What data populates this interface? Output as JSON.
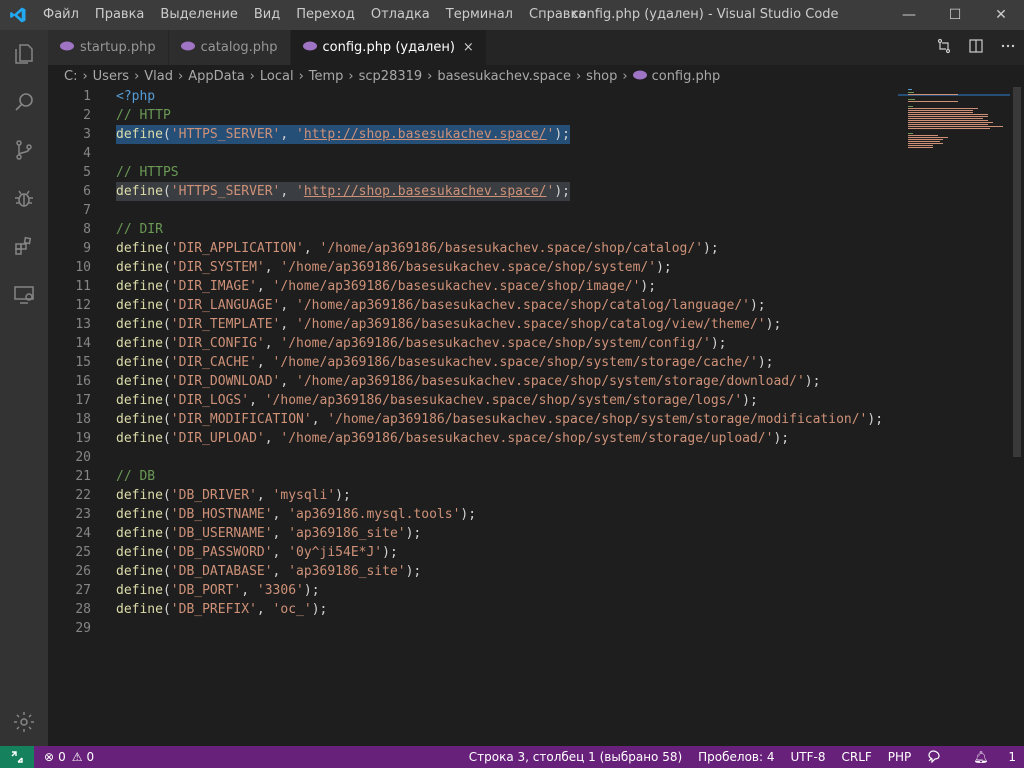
{
  "window": {
    "title": "config.php (удален) - Visual Studio Code",
    "menu": [
      "Файл",
      "Правка",
      "Выделение",
      "Вид",
      "Переход",
      "Отладка",
      "Терминал",
      "Справка"
    ],
    "controls": {
      "minimize": "—",
      "maximize": "☐",
      "close": "✕"
    }
  },
  "activity_bar": {
    "icons": [
      "explorer-icon",
      "search-icon",
      "source-control-icon",
      "debug-icon",
      "extensions-icon",
      "remote-explorer-icon"
    ],
    "bottom_icon": "settings-gear-icon"
  },
  "tabs": [
    {
      "label": "startup.php",
      "active": false
    },
    {
      "label": "catalog.php",
      "active": false
    },
    {
      "label": "config.php (удален)",
      "active": true,
      "close": "×"
    }
  ],
  "tab_actions": [
    "open-changes-icon",
    "split-editor-icon",
    "more-actions-icon"
  ],
  "breadcrumb": [
    "C:",
    "Users",
    "Vlad",
    "AppData",
    "Local",
    "Temp",
    "scp28319",
    "basesukachev.space",
    "shop",
    "config.php"
  ],
  "colors": {
    "accent": "#007acc",
    "statusbar": "#68217a",
    "remote": "#16825d",
    "php_icon": "#a074c4",
    "selection": "#264f78"
  },
  "code_lines": [
    {
      "n": "1",
      "tokens": [
        {
          "t": "kw",
          "v": "<?php"
        }
      ]
    },
    {
      "n": "2",
      "tokens": [
        {
          "t": "cmt",
          "v": "// HTTP"
        }
      ]
    },
    {
      "n": "3",
      "sel": true,
      "tokens": [
        {
          "t": "fn",
          "v": "define"
        },
        {
          "t": "pun",
          "v": "("
        },
        {
          "t": "str",
          "v": "'HTTPS_SERVER'"
        },
        {
          "t": "pun",
          "v": ", "
        },
        {
          "t": "str",
          "v": "'"
        },
        {
          "t": "url",
          "v": "http://shop.basesukachev.space/"
        },
        {
          "t": "str",
          "v": "'"
        },
        {
          "t": "pun",
          "v": ");"
        }
      ]
    },
    {
      "n": "4",
      "tokens": []
    },
    {
      "n": "5",
      "tokens": [
        {
          "t": "cmt",
          "v": "// HTTPS"
        }
      ]
    },
    {
      "n": "6",
      "hl": true,
      "tokens": [
        {
          "t": "fn",
          "v": "define"
        },
        {
          "t": "pun",
          "v": "("
        },
        {
          "t": "str",
          "v": "'HTTPS_SERVER'"
        },
        {
          "t": "pun",
          "v": ", "
        },
        {
          "t": "str",
          "v": "'"
        },
        {
          "t": "url",
          "v": "http://shop.basesukachev.space/"
        },
        {
          "t": "str",
          "v": "'"
        },
        {
          "t": "pun",
          "v": ");"
        }
      ]
    },
    {
      "n": "7",
      "tokens": []
    },
    {
      "n": "8",
      "tokens": [
        {
          "t": "cmt",
          "v": "// DIR"
        }
      ]
    },
    {
      "n": "9",
      "tokens": [
        {
          "t": "fn",
          "v": "define"
        },
        {
          "t": "pun",
          "v": "("
        },
        {
          "t": "str",
          "v": "'DIR_APPLICATION'"
        },
        {
          "t": "pun",
          "v": ", "
        },
        {
          "t": "str",
          "v": "'/home/ap369186/basesukachev.space/shop/catalog/'"
        },
        {
          "t": "pun",
          "v": ");"
        }
      ]
    },
    {
      "n": "10",
      "tokens": [
        {
          "t": "fn",
          "v": "define"
        },
        {
          "t": "pun",
          "v": "("
        },
        {
          "t": "str",
          "v": "'DIR_SYSTEM'"
        },
        {
          "t": "pun",
          "v": ", "
        },
        {
          "t": "str",
          "v": "'/home/ap369186/basesukachev.space/shop/system/'"
        },
        {
          "t": "pun",
          "v": ");"
        }
      ]
    },
    {
      "n": "11",
      "tokens": [
        {
          "t": "fn",
          "v": "define"
        },
        {
          "t": "pun",
          "v": "("
        },
        {
          "t": "str",
          "v": "'DIR_IMAGE'"
        },
        {
          "t": "pun",
          "v": ", "
        },
        {
          "t": "str",
          "v": "'/home/ap369186/basesukachev.space/shop/image/'"
        },
        {
          "t": "pun",
          "v": ");"
        }
      ]
    },
    {
      "n": "12",
      "tokens": [
        {
          "t": "fn",
          "v": "define"
        },
        {
          "t": "pun",
          "v": "("
        },
        {
          "t": "str",
          "v": "'DIR_LANGUAGE'"
        },
        {
          "t": "pun",
          "v": ", "
        },
        {
          "t": "str",
          "v": "'/home/ap369186/basesukachev.space/shop/catalog/language/'"
        },
        {
          "t": "pun",
          "v": ");"
        }
      ]
    },
    {
      "n": "13",
      "tokens": [
        {
          "t": "fn",
          "v": "define"
        },
        {
          "t": "pun",
          "v": "("
        },
        {
          "t": "str",
          "v": "'DIR_TEMPLATE'"
        },
        {
          "t": "pun",
          "v": ", "
        },
        {
          "t": "str",
          "v": "'/home/ap369186/basesukachev.space/shop/catalog/view/theme/'"
        },
        {
          "t": "pun",
          "v": ");"
        }
      ]
    },
    {
      "n": "14",
      "tokens": [
        {
          "t": "fn",
          "v": "define"
        },
        {
          "t": "pun",
          "v": "("
        },
        {
          "t": "str",
          "v": "'DIR_CONFIG'"
        },
        {
          "t": "pun",
          "v": ", "
        },
        {
          "t": "str",
          "v": "'/home/ap369186/basesukachev.space/shop/system/config/'"
        },
        {
          "t": "pun",
          "v": ");"
        }
      ]
    },
    {
      "n": "15",
      "tokens": [
        {
          "t": "fn",
          "v": "define"
        },
        {
          "t": "pun",
          "v": "("
        },
        {
          "t": "str",
          "v": "'DIR_CACHE'"
        },
        {
          "t": "pun",
          "v": ", "
        },
        {
          "t": "str",
          "v": "'/home/ap369186/basesukachev.space/shop/system/storage/cache/'"
        },
        {
          "t": "pun",
          "v": ");"
        }
      ]
    },
    {
      "n": "16",
      "tokens": [
        {
          "t": "fn",
          "v": "define"
        },
        {
          "t": "pun",
          "v": "("
        },
        {
          "t": "str",
          "v": "'DIR_DOWNLOAD'"
        },
        {
          "t": "pun",
          "v": ", "
        },
        {
          "t": "str",
          "v": "'/home/ap369186/basesukachev.space/shop/system/storage/download/'"
        },
        {
          "t": "pun",
          "v": ");"
        }
      ]
    },
    {
      "n": "17",
      "tokens": [
        {
          "t": "fn",
          "v": "define"
        },
        {
          "t": "pun",
          "v": "("
        },
        {
          "t": "str",
          "v": "'DIR_LOGS'"
        },
        {
          "t": "pun",
          "v": ", "
        },
        {
          "t": "str",
          "v": "'/home/ap369186/basesukachev.space/shop/system/storage/logs/'"
        },
        {
          "t": "pun",
          "v": ");"
        }
      ]
    },
    {
      "n": "18",
      "tokens": [
        {
          "t": "fn",
          "v": "define"
        },
        {
          "t": "pun",
          "v": "("
        },
        {
          "t": "str",
          "v": "'DIR_MODIFICATION'"
        },
        {
          "t": "pun",
          "v": ", "
        },
        {
          "t": "str",
          "v": "'/home/ap369186/basesukachev.space/shop/system/storage/modification/'"
        },
        {
          "t": "pun",
          "v": ");"
        }
      ]
    },
    {
      "n": "19",
      "tokens": [
        {
          "t": "fn",
          "v": "define"
        },
        {
          "t": "pun",
          "v": "("
        },
        {
          "t": "str",
          "v": "'DIR_UPLOAD'"
        },
        {
          "t": "pun",
          "v": ", "
        },
        {
          "t": "str",
          "v": "'/home/ap369186/basesukachev.space/shop/system/storage/upload/'"
        },
        {
          "t": "pun",
          "v": ");"
        }
      ]
    },
    {
      "n": "20",
      "tokens": []
    },
    {
      "n": "21",
      "tokens": [
        {
          "t": "cmt",
          "v": "// DB"
        }
      ]
    },
    {
      "n": "22",
      "tokens": [
        {
          "t": "fn",
          "v": "define"
        },
        {
          "t": "pun",
          "v": "("
        },
        {
          "t": "str",
          "v": "'DB_DRIVER'"
        },
        {
          "t": "pun",
          "v": ", "
        },
        {
          "t": "str",
          "v": "'mysqli'"
        },
        {
          "t": "pun",
          "v": ");"
        }
      ]
    },
    {
      "n": "23",
      "tokens": [
        {
          "t": "fn",
          "v": "define"
        },
        {
          "t": "pun",
          "v": "("
        },
        {
          "t": "str",
          "v": "'DB_HOSTNAME'"
        },
        {
          "t": "pun",
          "v": ", "
        },
        {
          "t": "str",
          "v": "'ap369186.mysql.tools'"
        },
        {
          "t": "pun",
          "v": ");"
        }
      ]
    },
    {
      "n": "24",
      "tokens": [
        {
          "t": "fn",
          "v": "define"
        },
        {
          "t": "pun",
          "v": "("
        },
        {
          "t": "str",
          "v": "'DB_USERNAME'"
        },
        {
          "t": "pun",
          "v": ", "
        },
        {
          "t": "str",
          "v": "'ap369186_site'"
        },
        {
          "t": "pun",
          "v": ");"
        }
      ]
    },
    {
      "n": "25",
      "tokens": [
        {
          "t": "fn",
          "v": "define"
        },
        {
          "t": "pun",
          "v": "("
        },
        {
          "t": "str",
          "v": "'DB_PASSWORD'"
        },
        {
          "t": "pun",
          "v": ", "
        },
        {
          "t": "str",
          "v": "'0y^ji54E*J'"
        },
        {
          "t": "pun",
          "v": ");"
        }
      ]
    },
    {
      "n": "26",
      "tokens": [
        {
          "t": "fn",
          "v": "define"
        },
        {
          "t": "pun",
          "v": "("
        },
        {
          "t": "str",
          "v": "'DB_DATABASE'"
        },
        {
          "t": "pun",
          "v": ", "
        },
        {
          "t": "str",
          "v": "'ap369186_site'"
        },
        {
          "t": "pun",
          "v": ");"
        }
      ]
    },
    {
      "n": "27",
      "tokens": [
        {
          "t": "fn",
          "v": "define"
        },
        {
          "t": "pun",
          "v": "("
        },
        {
          "t": "str",
          "v": "'DB_PORT'"
        },
        {
          "t": "pun",
          "v": ", "
        },
        {
          "t": "str",
          "v": "'3306'"
        },
        {
          "t": "pun",
          "v": ");"
        }
      ]
    },
    {
      "n": "28",
      "tokens": [
        {
          "t": "fn",
          "v": "define"
        },
        {
          "t": "pun",
          "v": "("
        },
        {
          "t": "str",
          "v": "'DB_PREFIX'"
        },
        {
          "t": "pun",
          "v": ", "
        },
        {
          "t": "str",
          "v": "'oc_'"
        },
        {
          "t": "pun",
          "v": ");"
        }
      ]
    },
    {
      "n": "29",
      "tokens": []
    }
  ],
  "statusbar": {
    "errors": "0",
    "warnings": "0",
    "position": "Строка 3, столбец 1 (выбрано 58)",
    "indent": "Пробелов: 4",
    "encoding": "UTF-8",
    "eol": "CRLF",
    "language": "PHP",
    "notifications": "1"
  }
}
